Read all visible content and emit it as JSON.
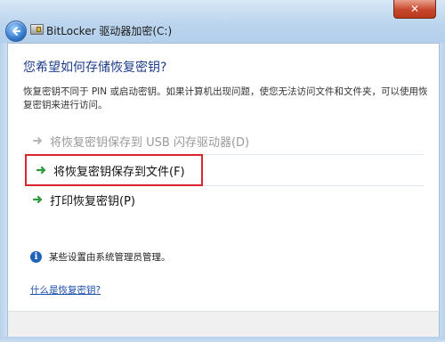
{
  "window": {
    "title": "BitLocker 驱动器加密(C:)",
    "close_glyph": "✕"
  },
  "heading": "您希望如何存储恢复密钥?",
  "description": "恢复密钥不同于 PIN 或启动密钥。如果计算机出现问题，使您无法访问文件和文件夹，可以使用恢复密钥来进行访问。",
  "options": [
    {
      "label": "将恢复密钥保存到 USB 闪存驱动器(D)",
      "enabled": false
    },
    {
      "label": "将恢复密钥保存到文件(F)",
      "enabled": true,
      "highlighted": true
    },
    {
      "label": "打印恢复密钥(P)",
      "enabled": true
    }
  ],
  "note": "某些设置由系统管理员管理。",
  "help_link": "什么是恢复密钥?",
  "colors": {
    "heading": "#1e3d8a",
    "arrow_green": "#2e9a3a",
    "highlight_border": "#d7262c",
    "link": "#1f4fae"
  },
  "icons": [
    "back-arrow-icon",
    "drive-icon",
    "close-icon",
    "green-arrow-icon",
    "info-icon"
  ]
}
